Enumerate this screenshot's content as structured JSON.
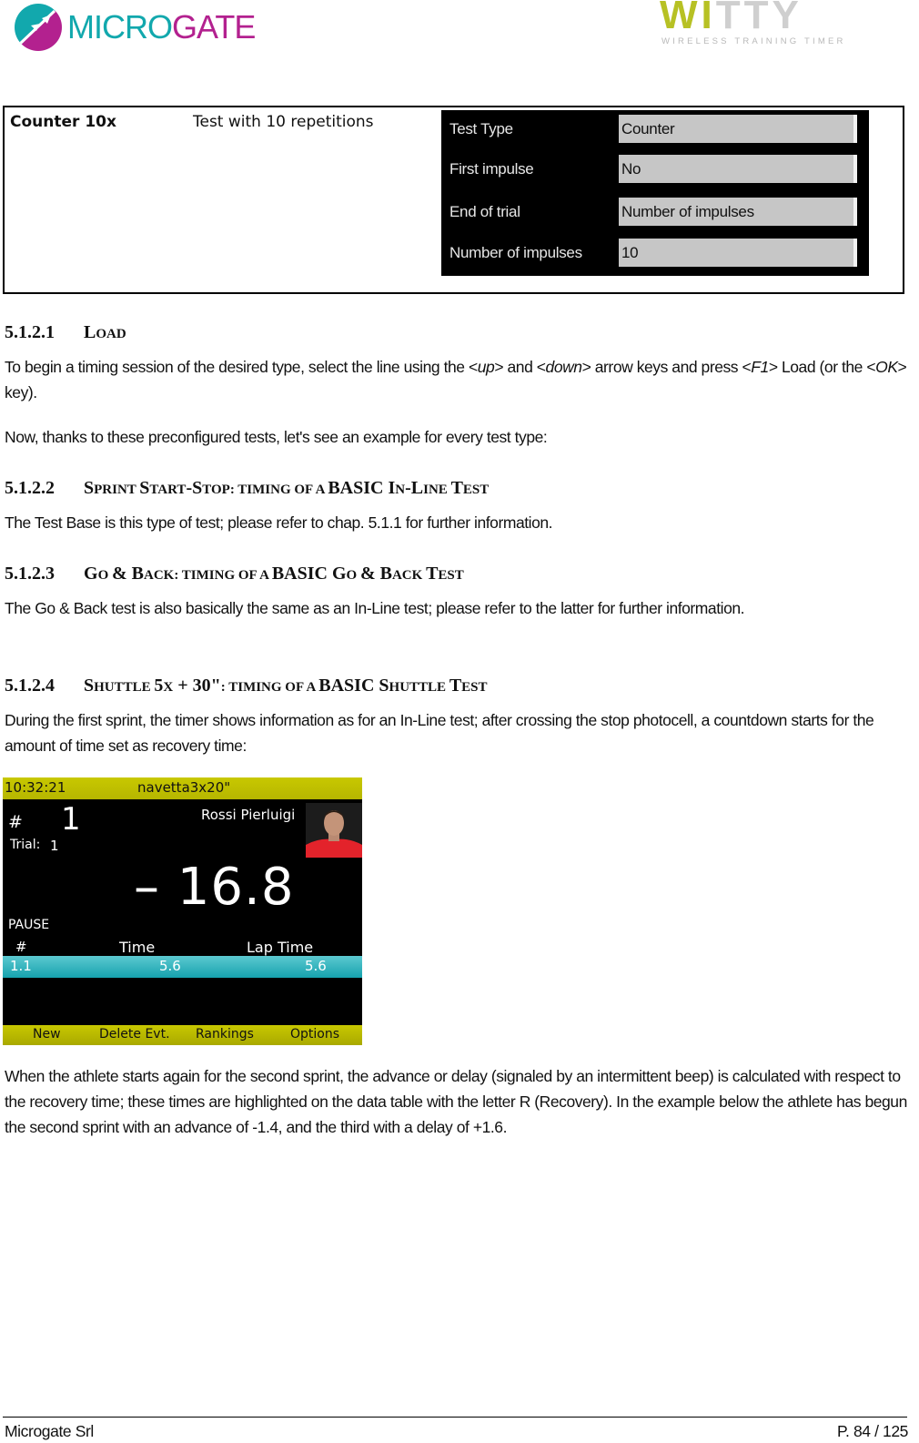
{
  "header": {
    "brand_left_part1": "MICRO",
    "brand_left_part2": "GATE",
    "brand_right_part1": "WI",
    "brand_right_part2": "TTY",
    "brand_right_tagline": "WIRELESS TRAINING TIMER",
    "icon": "microgate-logo-icon",
    "colors": {
      "microgate_teal": "#12a8ad",
      "microgate_magenta": "#b3218f",
      "witty_green": "#b7c124",
      "witty_gray": "#cfcfcf"
    }
  },
  "test_table": {
    "name": "Counter 10x",
    "description": "Test with 10 repetitions",
    "config_rows": [
      {
        "label": "Test Type",
        "value": "Counter"
      },
      {
        "label": "First impulse",
        "value": "No"
      },
      {
        "label": "End of trial",
        "value": "Number of impulses"
      },
      {
        "label": "Number of impulses",
        "value": "10"
      }
    ]
  },
  "sections": [
    {
      "number": "5.1.2.1",
      "title_parts": [
        [
          "L",
          "l"
        ],
        [
          "OAD",
          "s"
        ]
      ],
      "paragraphs": []
    }
  ],
  "s1": {
    "number": "5.1.2.1",
    "title_l1": "L",
    "title_s1": "OAD",
    "p1_a": "To begin a timing session of the desired type, select the line using the <",
    "p1_up": "up",
    "p1_b": "> and <",
    "p1_down": "down",
    "p1_c": "> arrow keys and press <",
    "p1_f1": "F1",
    "p1_d": "> Load (or the <",
    "p1_ok": "OK",
    "p1_e": "> key).",
    "p2": "Now, thanks to these preconfigured tests, let's see an example for every test type:"
  },
  "s2": {
    "number": "5.1.2.2",
    "t1": "S",
    "t2": "PRINT ",
    "t3": "S",
    "t4": "TART",
    "t5": "-S",
    "t6": "TOP",
    "t7": ": TIMING OF A ",
    "t8": "BASIC ",
    "t9": "I",
    "t10": "N",
    "t11": "-L",
    "t12": "INE ",
    "t13": "T",
    "t14": "EST",
    "p1": "The Test Base is this type of test; please refer to chap. 5.1.1 for further information."
  },
  "s3": {
    "number": "5.1.2.3",
    "t1": "G",
    "t2": "O ",
    "t3": "& B",
    "t4": "ACK",
    "t5": ": TIMING OF A ",
    "t6": "BASIC G",
    "t7": "O ",
    "t8": "& B",
    "t9": "ACK ",
    "t10": "T",
    "t11": "EST",
    "p1": "The Go & Back test is also basically the same as an In-Line test; please refer to the latter for further information."
  },
  "s4": {
    "number": "5.1.2.4",
    "t1": "S",
    "t2": "HUTTLE ",
    "t3": "5",
    "t4": "X",
    "t5": " + 30\"",
    "t6": ": TIMING OF A ",
    "t7": "BASIC S",
    "t8": "HUTTLE ",
    "t9": "T",
    "t10": "EST",
    "p1": "During the first sprint, the timer shows information as for an In-Line test; after crossing the stop photocell, a countdown starts for the amount of time set as recovery time:",
    "p2": "When the athlete starts again for the second sprint, the advance or delay (signaled by an intermittent beep) is calculated with respect to the recovery time; these times are highlighted on the data table with the letter R (Recovery). In the example below the athlete has begun the second sprint with an advance of -1.4, and the third with a delay of +1.6."
  },
  "device": {
    "clock": "10:32:21",
    "test_name": "navetta3x20\"",
    "hash_label": "#",
    "bib": "1",
    "trial_label": "Trial:",
    "trial_value": "1",
    "athlete_name": "Rossi  Pierluigi",
    "countdown": "–  16.8",
    "status": "PAUSE",
    "col_hash": "#",
    "col_time": "Time",
    "col_lap": "Lap  Time",
    "row": {
      "id": "1.1",
      "time": "5.6",
      "lap": "5.6"
    },
    "softkeys": [
      "New",
      "Delete  Evt.",
      "Rankings",
      "Options"
    ],
    "colors": {
      "top_bar": "#c8c800",
      "row_highlight": "#16a2ae"
    }
  },
  "footer": {
    "company": "Microgate Srl",
    "page": "P. 84 / 125"
  }
}
